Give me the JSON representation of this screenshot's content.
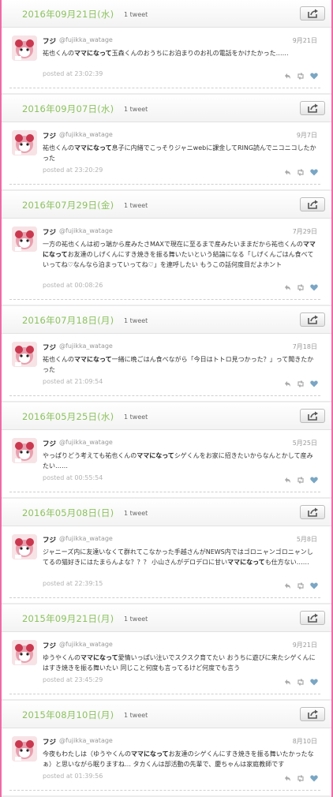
{
  "user": {
    "name": "フジ",
    "handle": "@fujikka_watage"
  },
  "count_label": "1 tweet",
  "days": [
    {
      "date": "2016年09月21日(水)",
      "tweet_date": "9月21日",
      "text_parts": [
        "祐也くんの",
        "ママになって",
        "玉森くんのおうちにお泊まりのお礼の電話をかけたかった……"
      ],
      "posted": "posted at 23:02:39"
    },
    {
      "date": "2016年09月07日(水)",
      "tweet_date": "9月7日",
      "text_parts": [
        "祐也くんの",
        "ママになって",
        "息子に内緒でこっそりジャニwebに課金してRING読んでニコニコしたかった"
      ],
      "posted": "posted at 23:20:29"
    },
    {
      "date": "2016年07月29日(金)",
      "tweet_date": "7月29日",
      "text_parts": [
        "一方の祐也くんは初っ端から産みたさMAXで現在に至るまで産みたいままだから祐也くんの",
        "ママになって",
        "お友達のしげくんにすき焼きを振る舞いたいという結論になる「しげくんごはん食べていってね♡なんなら泊まっていってね♡」を連呼したい もうこの話何度目だよホント"
      ],
      "posted": "posted at 00:08:26"
    },
    {
      "date": "2016年07月18日(月)",
      "tweet_date": "7月18日",
      "text_parts": [
        "祐也くんの",
        "ママになって",
        "一緒に晩ごはん食べながら「今日はトトロ見つかった？」って聞きたかった"
      ],
      "posted": "posted at 21:09:54"
    },
    {
      "date": "2016年05月25日(水)",
      "tweet_date": "5月25日",
      "text_parts": [
        "やっぱりどう考えても祐也くんの",
        "ママになって",
        "シゲくんをお家に招きたいからなんとかして産みたい……"
      ],
      "posted": "posted at 00:55:54"
    },
    {
      "date": "2016年05月08日(日)",
      "tweet_date": "5月8日",
      "text_parts": [
        "ジャニーズ内に友達いなくて群れてこなかった手越さんがNEWS内ではゴロニャンゴロニャンしてるの猫好きにはたまらんよな？？？ 小山さんがデロデロに甘い",
        "ママになって",
        "も仕方ない……"
      ],
      "posted": "posted at 22:39:15"
    },
    {
      "date": "2015年09月21日(月)",
      "tweet_date": "9月21日",
      "text_parts": [
        "ゆうやくんの",
        "ママになって",
        "愛情いっぱい注いでスクスク育てたい おうちに遊びに来たシゲくんにはすき焼きを振る舞いたい 同じこと何度も言ってるけど何度でも言う"
      ],
      "posted": "posted at 23:45:29"
    },
    {
      "date": "2015年08月10日(月)",
      "tweet_date": "8月10日",
      "text_parts": [
        "今夜もわたしは（ゆうやくんの",
        "ママになって",
        "お友達のシゲくんにすき焼きを振る舞いたかったなぁ）と思いながら眠りますね… タカくんは部活動の先輩で、慶ちゃんは家庭教師です"
      ],
      "posted": "posted at 01:39:56"
    }
  ]
}
